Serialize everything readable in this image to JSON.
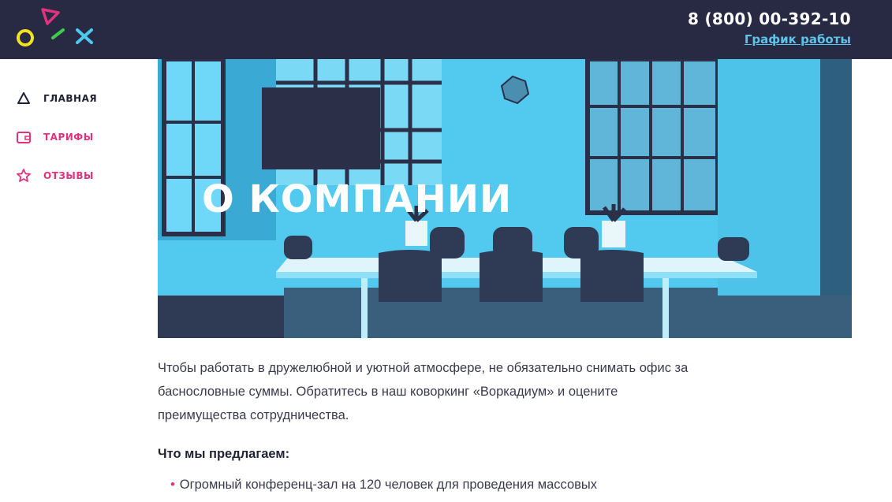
{
  "header": {
    "phone": "8 (800) 00-392-10",
    "schedule_link": "График работы",
    "colors": {
      "background": "#282a44",
      "accent": "#5ec3e8"
    }
  },
  "sidebar": {
    "items": [
      {
        "label": "ГЛАВНАЯ",
        "icon": "triangle-icon",
        "active": true
      },
      {
        "label": "ТАРИФЫ",
        "icon": "wallet-icon",
        "active": false
      },
      {
        "label": "ОТЗЫВЫ",
        "icon": "star-icon",
        "active": false
      }
    ],
    "accent_color": "#e0327f"
  },
  "hero": {
    "title": "О КОМПАНИИ",
    "image": "office-meeting-room-photo"
  },
  "content": {
    "intro": "Чтобы работать в дружелюбной и уютной атмосфере, не обязательно снимать офис за баснословные суммы. Обратитесь в наш коворкинг «Воркадиум» и оцените преимущества сотрудничества.",
    "offer_title": "Что мы предлагаем:",
    "offers": [
      "Огромный конференц-зал на 120 человек для проведения массовых"
    ]
  }
}
